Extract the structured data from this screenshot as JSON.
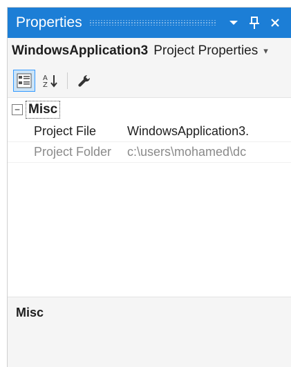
{
  "panel": {
    "title": "Properties",
    "controls": {
      "dropdown_icon": "▼",
      "pin_icon": "📌",
      "close_icon": "✕"
    }
  },
  "object_selector": {
    "name": "WindowsApplication3",
    "type": "Project Properties",
    "dropdown_icon": "▾"
  },
  "toolbar": {
    "buttons": [
      {
        "name": "categorized-icon",
        "active": true
      },
      {
        "name": "alphabetical-icon",
        "active": false
      },
      {
        "name": "property-pages-icon",
        "active": false
      }
    ]
  },
  "grid": {
    "category": {
      "expander": "⊟",
      "label": "Misc"
    },
    "properties": [
      {
        "name": "Project File",
        "value": "WindowsApplication3.",
        "disabled": false
      },
      {
        "name": "Project Folder",
        "value": "c:\\users\\mohamed\\dc",
        "disabled": true
      }
    ]
  },
  "description": {
    "title": "Misc"
  },
  "colors": {
    "accent": "#1c7ed6",
    "panel_bg": "#f5f5f5",
    "grid_bg": "#ffffff"
  }
}
